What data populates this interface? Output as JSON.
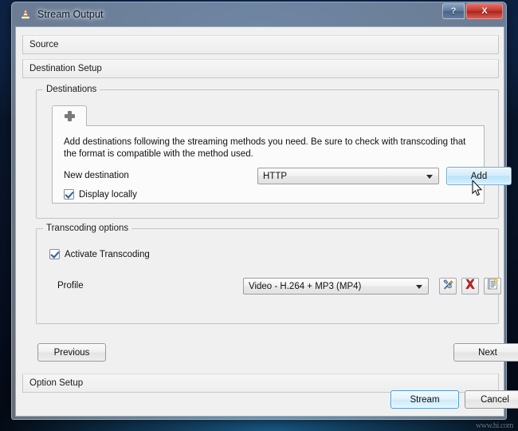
{
  "window": {
    "title": "Stream Output",
    "app_icon": "vlc-cone-icon",
    "help_label": "?",
    "close_label": "X"
  },
  "sections": [
    {
      "id": "source",
      "label": "Source"
    },
    {
      "id": "destination_setup",
      "label": "Destination Setup"
    },
    {
      "id": "option_setup",
      "label": "Option Setup"
    }
  ],
  "destinations": {
    "group_title": "Destinations",
    "tab_icon": "plus-icon",
    "description": "Add destinations following the streaming methods you need. Be sure to check with transcoding that the format is compatible with the method used.",
    "new_destination": {
      "label": "New destination",
      "value": "HTTP"
    },
    "add_button": "Add",
    "display_locally": {
      "label": "Display locally",
      "checked": true
    }
  },
  "transcoding": {
    "group_title": "Transcoding options",
    "activate": {
      "label": "Activate Transcoding",
      "checked": true
    },
    "profile": {
      "label": "Profile",
      "value": "Video - H.264 + MP3 (MP4)"
    },
    "tools": [
      {
        "name": "edit-profile-icon"
      },
      {
        "name": "delete-profile-icon"
      },
      {
        "name": "new-profile-icon"
      }
    ]
  },
  "navigation": {
    "previous": "Previous",
    "next": "Next"
  },
  "actions": {
    "stream": "Stream",
    "cancel": "Cancel"
  },
  "watermark": "www.hi.com",
  "colors": {
    "accent": "#4a9ad4",
    "close_red": "#c3352c",
    "checkmark": "#2a5fa8",
    "delete_red": "#cc2222"
  }
}
